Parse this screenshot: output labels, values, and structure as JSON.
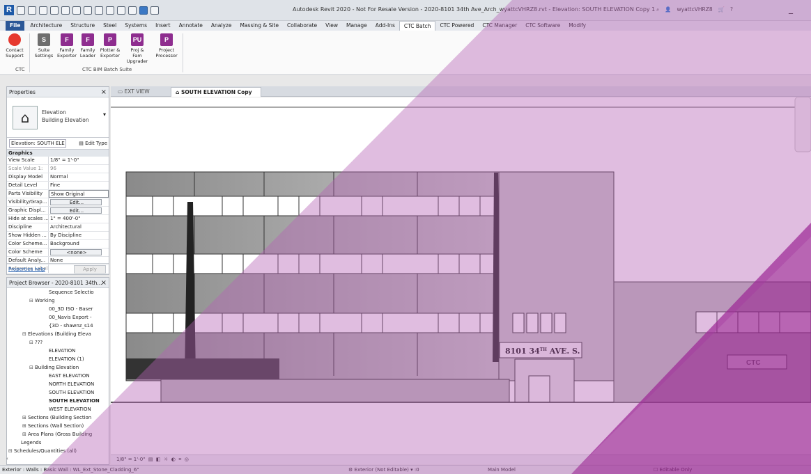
{
  "titlebar": {
    "title": "Autodesk Revit 2020 - Not For Resale Version - 2020-8101 34th Ave_Arch_wyattcVHRZ8.rvt - Elevation: SOUTH ELEVATION Copy 1",
    "user": "wyattcVHRZ8"
  },
  "ribbon_tabs": [
    "File",
    "Architecture",
    "Structure",
    "Steel",
    "Systems",
    "Insert",
    "Annotate",
    "Analyze",
    "Massing & Site",
    "Collaborate",
    "View",
    "Manage",
    "Add-Ins",
    "CTC Batch",
    "CTC Powered",
    "CTC Manager",
    "CTC Software",
    "Modify"
  ],
  "ribbon": {
    "tools": [
      {
        "l1": "Contact",
        "l2": "Support",
        "icon": "support-icon"
      },
      {
        "l1": "Suite",
        "l2": "Settings",
        "icon": "settings-icon"
      },
      {
        "l1": "Family",
        "l2": "Exporter",
        "icon": "family-exporter-icon"
      },
      {
        "l1": "Family",
        "l2": "Loader",
        "icon": "family-loader-icon"
      },
      {
        "l1": "Plotter &",
        "l2": "Exporter",
        "icon": "plotter-exporter-icon"
      },
      {
        "l1": "Proj & Fam",
        "l2": "Upgrader",
        "icon": "upgrader-icon"
      },
      {
        "l1": "Project",
        "l2": "Processor",
        "icon": "project-processor-icon"
      }
    ],
    "panel_ctc": "CTC",
    "panel_suite": "CTC BIM Batch Suite"
  },
  "properties": {
    "header": "Properties",
    "type_name_1": "Elevation",
    "type_name_2": "Building Elevation",
    "instance": "Elevation: SOUTH ELE",
    "edit_type": "Edit Type",
    "group": "Graphics",
    "rows": [
      {
        "k": "View Scale",
        "v": "1/8\" = 1'-0\""
      },
      {
        "k": "Scale Value    1:",
        "v": "96"
      },
      {
        "k": "Display Model",
        "v": "Normal"
      },
      {
        "k": "Detail Level",
        "v": "Fine"
      },
      {
        "k": "Parts Visibility",
        "v": "Show Original"
      },
      {
        "k": "Visibility/Grap...",
        "v": "Edit..."
      },
      {
        "k": "Graphic Displ...",
        "v": "Edit..."
      },
      {
        "k": "Hide at scales ...",
        "v": "1\" = 400'-0\""
      },
      {
        "k": "Discipline",
        "v": "Architectural"
      },
      {
        "k": "Show Hidden ...",
        "v": "By Discipline"
      },
      {
        "k": "Color Scheme...",
        "v": "Background"
      },
      {
        "k": "Color Scheme",
        "v": "<none>"
      },
      {
        "k": "Default Analy...",
        "v": "None"
      },
      {
        "k": "Reference Label",
        "v": ""
      }
    ],
    "help": "Properties help",
    "apply": "Apply"
  },
  "browser": {
    "header": "Project Browser - 2020-8101 34th...",
    "items": [
      {
        "t": "Sequence Selectio",
        "i": 5,
        "e": ""
      },
      {
        "t": "Working",
        "i": 3,
        "e": "-"
      },
      {
        "t": "00_3D ISO - Baser",
        "i": 5,
        "e": ""
      },
      {
        "t": "00_Navis Export -",
        "i": 5,
        "e": ""
      },
      {
        "t": "{3D - shawnz_s14",
        "i": 5,
        "e": ""
      },
      {
        "t": "Elevations (Building Eleva",
        "i": 2,
        "e": "-"
      },
      {
        "t": "???",
        "i": 3,
        "e": "-"
      },
      {
        "t": "ELEVATION",
        "i": 5,
        "e": ""
      },
      {
        "t": "ELEVATION (1)",
        "i": 5,
        "e": ""
      },
      {
        "t": "Building Elevation",
        "i": 3,
        "e": "-"
      },
      {
        "t": "EAST ELEVATION",
        "i": 5,
        "e": ""
      },
      {
        "t": "NORTH ELEVATION",
        "i": 5,
        "e": ""
      },
      {
        "t": "SOUTH ELEVATION",
        "i": 5,
        "e": ""
      },
      {
        "t": "SOUTH ELEVATION",
        "i": 5,
        "e": "",
        "bold": true
      },
      {
        "t": "WEST ELEVATION",
        "i": 5,
        "e": ""
      },
      {
        "t": "Sections (Building Section",
        "i": 2,
        "e": "+"
      },
      {
        "t": "Sections (Wall Section)",
        "i": 2,
        "e": "+"
      },
      {
        "t": "Area Plans (Gross Building",
        "i": 2,
        "e": "+"
      },
      {
        "t": "Legends",
        "i": 1,
        "e": ""
      },
      {
        "t": "Schedules/Quantities (all)",
        "i": 0,
        "e": "-"
      }
    ]
  },
  "doc_tabs": [
    "EXT VIEW",
    "SOUTH ELEVATION Copy 1"
  ],
  "drawing": {
    "address": "8101 34",
    "address_sup": "TH",
    "address_tail": " AVE. S.",
    "sign": "CTC"
  },
  "viewbar": {
    "scale": "1/8\" = 1'-0\""
  },
  "status": {
    "text": "Exterior : Walls : Basic Wall : WL_Ext_Stone_Cladding_6\"",
    "workset": "Exterior (Not Editable)",
    "model": "Main Model",
    "editable": "Editable Only",
    "zero": ":0"
  },
  "colors": {
    "accent": "#8e2d8f",
    "ribbon_file": "#2b5797",
    "overlay_light": "#c084c6",
    "overlay_dark": "#9c2a96"
  }
}
